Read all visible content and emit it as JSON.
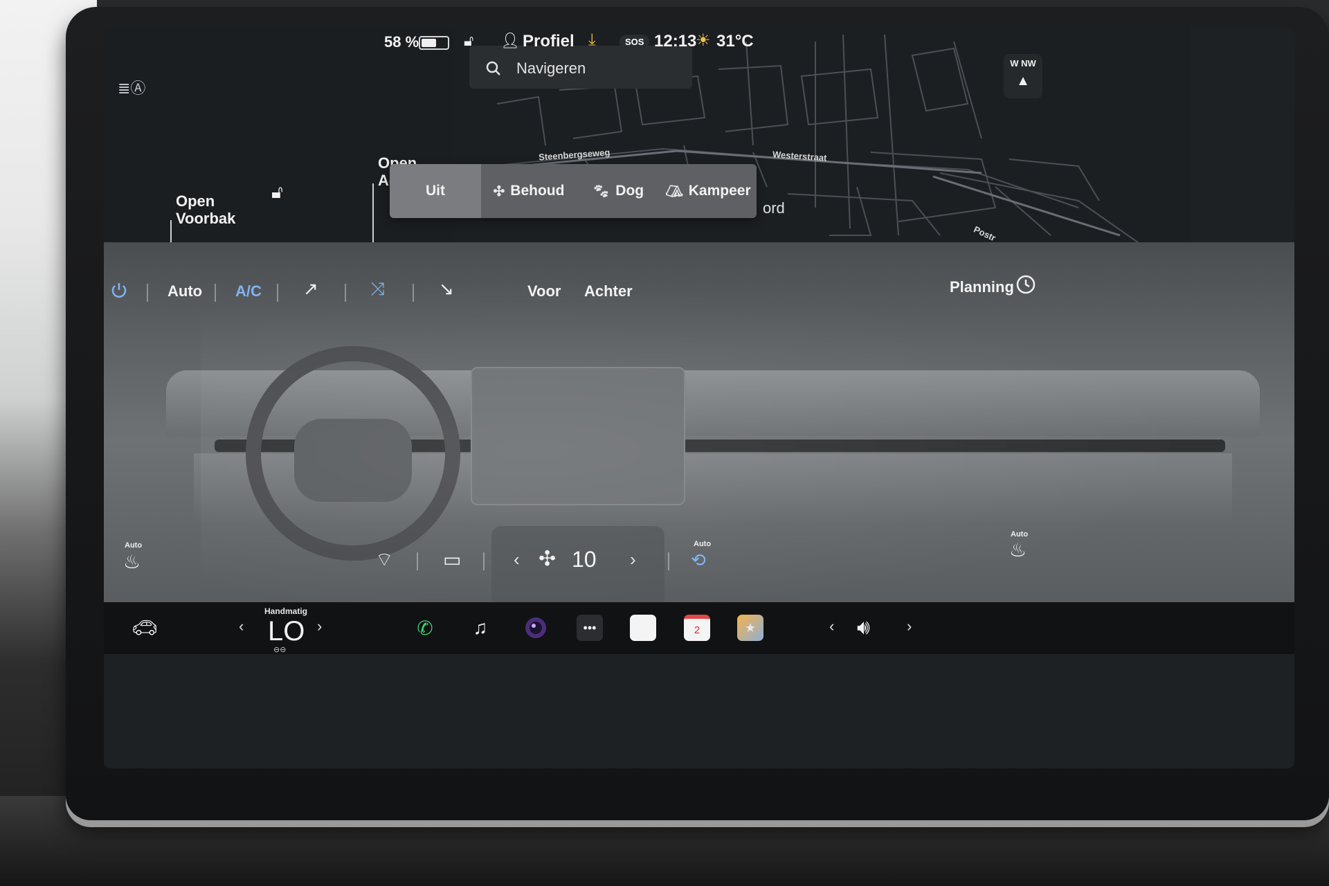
{
  "status_bar": {
    "battery_pct": "58 %",
    "battery_level": 0.58,
    "profile_label": "Profiel",
    "sos_label": "SOS",
    "time": "12:13",
    "temperature": "31°C"
  },
  "car_panel": {
    "frunk_label": "Open Voorbak",
    "trunk_label": "Open Ac"
  },
  "map": {
    "search_placeholder": "Navigeren",
    "compass_dir": "W  NW",
    "street_1": "Steenbergseweg",
    "street_2": "Westerstraat",
    "street_3": "Postr",
    "partial_label": "ord"
  },
  "climate_keeper": {
    "options": [
      "Uit",
      "Behoud",
      "Dog",
      "Kampeer"
    ],
    "selected": "Uit"
  },
  "climate": {
    "auto_label": "Auto",
    "ac_label": "A/C",
    "front_label": "Voor",
    "rear_label": "Achter",
    "planning_label": "Planning",
    "seat_left_auto": "Auto",
    "seat_right_auto": "Auto",
    "recirc_auto": "Auto",
    "fan_speed": "10"
  },
  "dock": {
    "temp_mode": "Handmatig",
    "temp_value": "LO",
    "calendar_day": "2"
  },
  "colors": {
    "accent_blue": "#7fb4f2",
    "download_yellow": "#e8b93a",
    "phone_green": "#3ccf6c"
  }
}
